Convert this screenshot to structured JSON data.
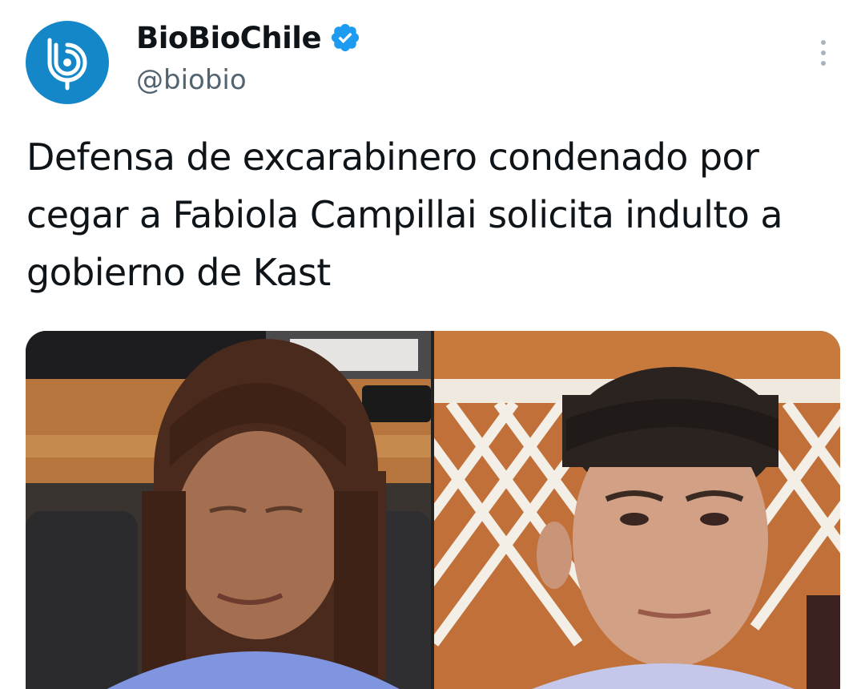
{
  "account": {
    "display_name": "BioBioChile",
    "handle": "@biobio",
    "verified": true,
    "avatar_icon": "biobio-logo-icon",
    "brand_color": "#1487c9"
  },
  "tweet": {
    "text": "Defensa de excarabinero condenado por cegar a Fabiola Campillai solicita indulto a gobierno de Kast"
  },
  "icons": {
    "verified": "verified-badge-icon",
    "more": "more-options-icon"
  },
  "colors": {
    "text": "#0f1419",
    "secondary_text": "#536471",
    "verified_blue": "#1d9bf0"
  }
}
